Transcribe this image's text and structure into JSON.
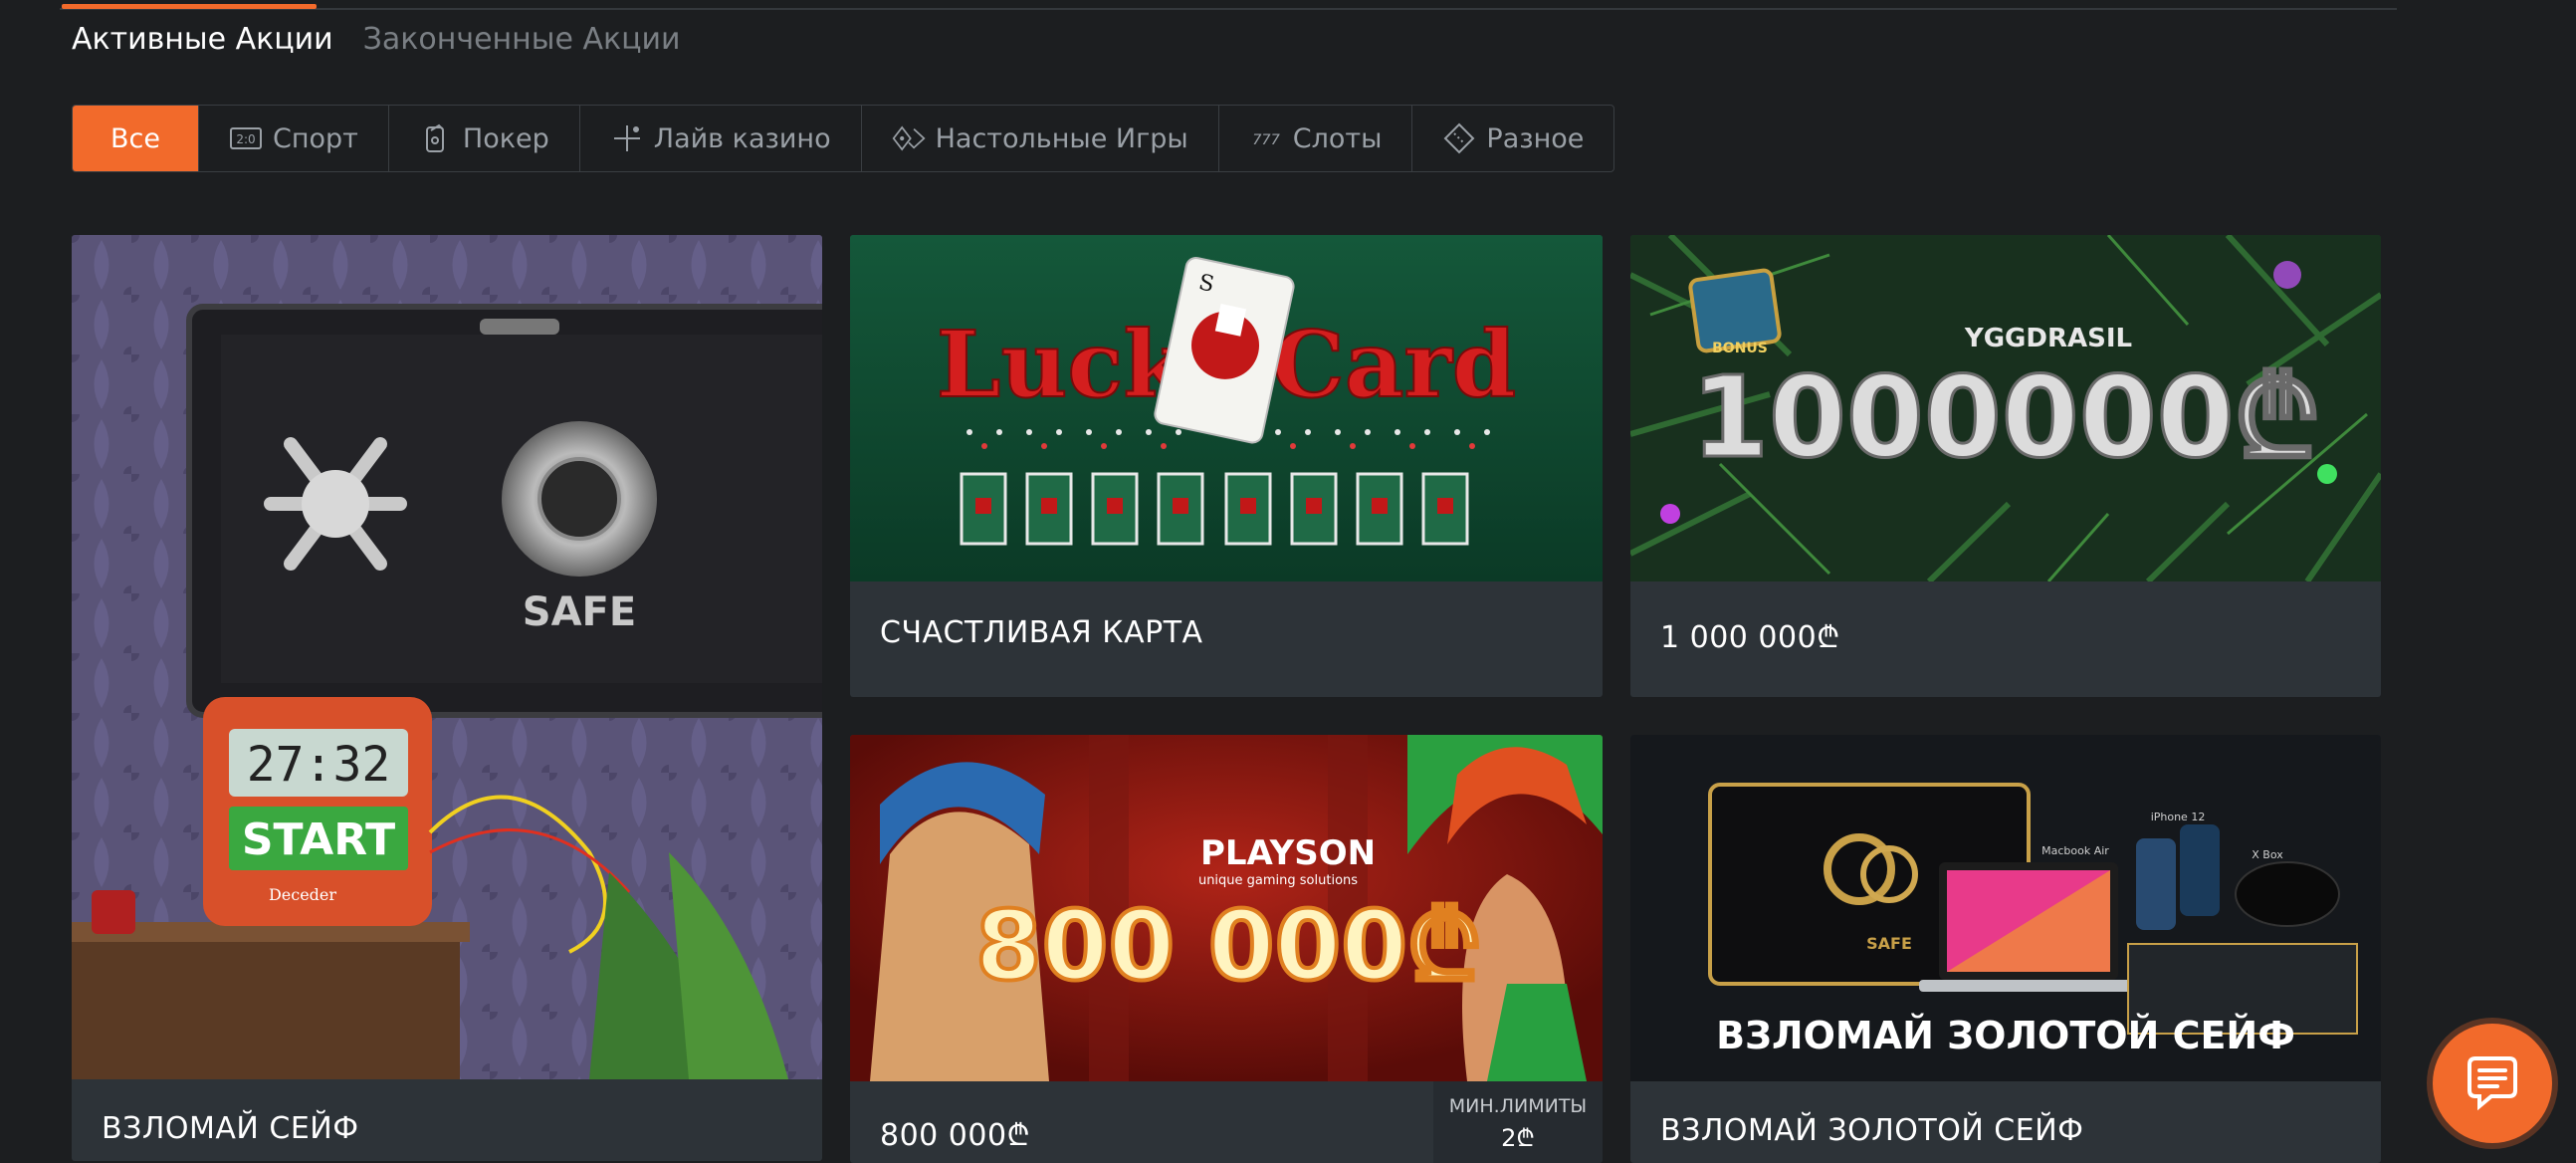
{
  "tabs": {
    "active": "Активные Акции",
    "finished": "Законченные Акции"
  },
  "filters": [
    {
      "label": "Все",
      "icon": "none"
    },
    {
      "label": "Спорт",
      "icon": "scoreboard-icon"
    },
    {
      "label": "Покер",
      "icon": "poker-chip-icon"
    },
    {
      "label": "Лайв казино",
      "icon": "live-icon"
    },
    {
      "label": "Настольные Игры",
      "icon": "dice-icon"
    },
    {
      "label": "Слоты",
      "icon": "slots-icon"
    },
    {
      "label": "Разное",
      "icon": "ticket-icon"
    }
  ],
  "promos": [
    {
      "title": "ВЗЛОМАЙ СЕЙФ"
    },
    {
      "title": "СЧАСТЛИВАЯ КАРТА",
      "banner": "Lucky Card"
    },
    {
      "title": "1 000 000₾",
      "banner": "1000000₾",
      "brand": "YGGDRASIL",
      "badge": "BONUS"
    },
    {
      "title": "800 000₾",
      "banner": "800 000₾",
      "brand": "PLAYSON",
      "brand_sub": "unique gaming solutions",
      "limits_label": "МИН.ЛИМИТЫ",
      "limits_value": "2₾"
    },
    {
      "title": "ВЗЛОМАЙ ЗОЛОТОЙ СЕЙФ",
      "banner": "ВЗЛОМАЙ ЗОЛОТОЙ СЕЙФ"
    }
  ],
  "safe_banner": {
    "safe_label": "SAFE",
    "timer": "27:32",
    "start": "START",
    "brand": "Deceder"
  },
  "gold_banner": {
    "safe_label": "SAFE",
    "laptop": "Macbook Air",
    "phone": "iPhone 12",
    "console": "X Box"
  },
  "colors": {
    "accent": "#f26a2b",
    "background": "#1c1e20",
    "card": "#2d3338"
  }
}
